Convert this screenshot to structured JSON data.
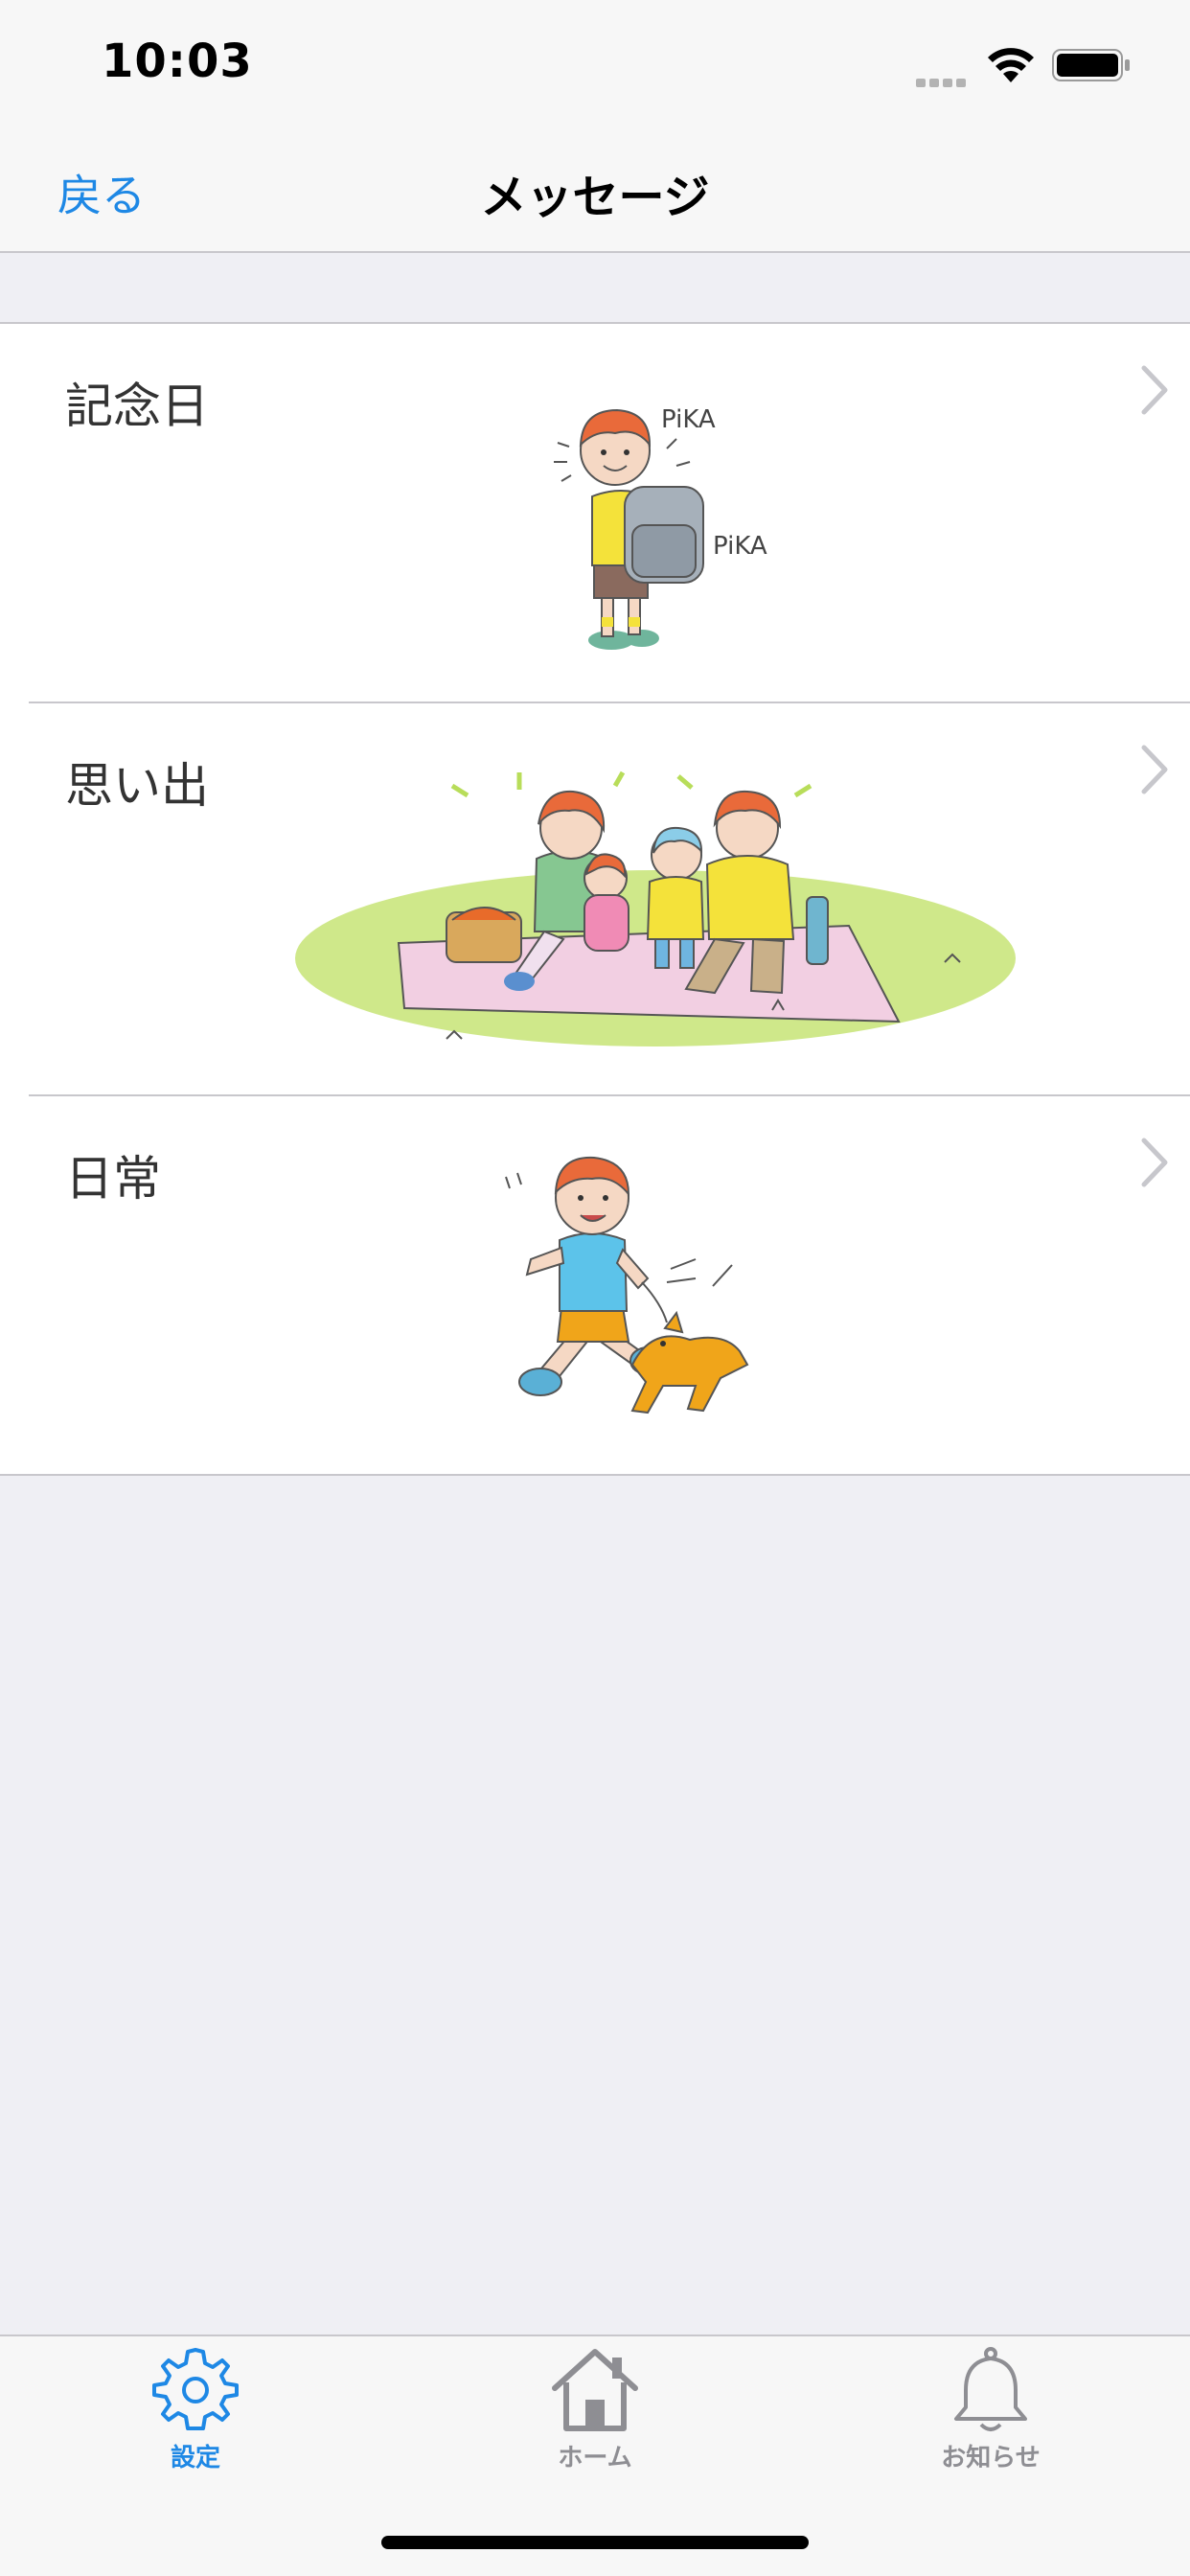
{
  "status_bar": {
    "time": "10:03"
  },
  "nav": {
    "back_label": "戻る",
    "title": "メッセージ"
  },
  "list": {
    "items": [
      {
        "label": "記念日",
        "illustration": "child-with-school-backpack",
        "pika1": "PiKA",
        "pika2": "PiKA"
      },
      {
        "label": "思い出",
        "illustration": "family-picnic"
      },
      {
        "label": "日常",
        "illustration": "boy-running-with-dog"
      }
    ]
  },
  "tab_bar": {
    "tabs": [
      {
        "label": "設定",
        "icon": "gear-icon",
        "selected": true
      },
      {
        "label": "ホーム",
        "icon": "home-icon",
        "selected": false
      },
      {
        "label": "お知らせ",
        "icon": "bell-icon",
        "selected": false
      }
    ],
    "active_color": "#1e88e5",
    "inactive_color": "#8e8e93"
  }
}
